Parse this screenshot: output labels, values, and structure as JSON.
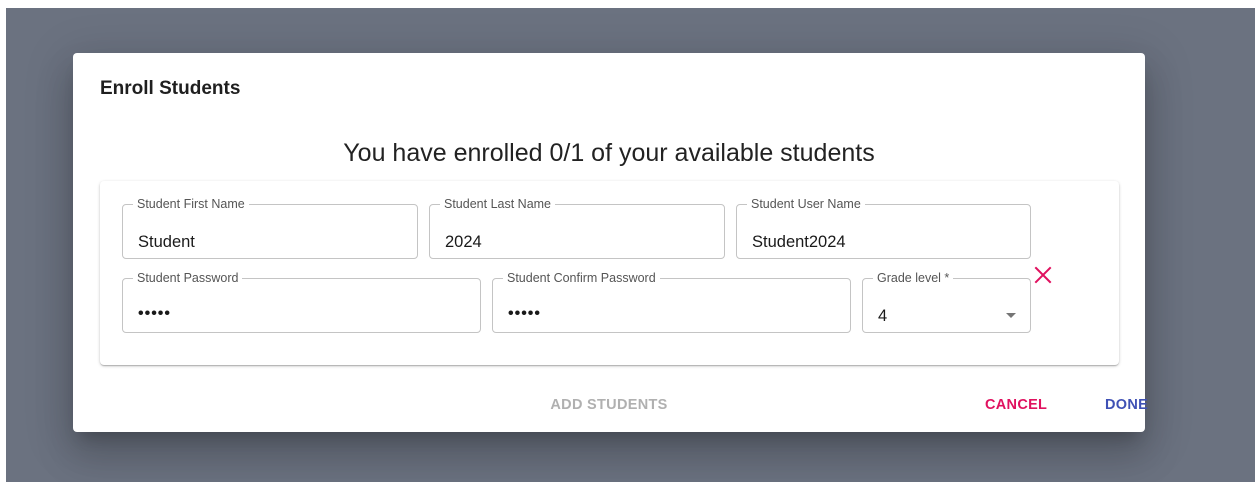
{
  "dialog": {
    "title": "Enroll Students",
    "subtitle": "You have enrolled 0/1 of your available students"
  },
  "student": {
    "first_name": {
      "label": "Student First Name",
      "value": "Student"
    },
    "last_name": {
      "label": "Student Last Name",
      "value": "2024"
    },
    "user_name": {
      "label": "Student User Name",
      "value": "Student2024"
    },
    "password": {
      "label": "Student Password",
      "value": "•••••"
    },
    "confirm_password": {
      "label": "Student Confirm Password",
      "value": "•••••"
    },
    "grade_level": {
      "label": "Grade level *",
      "value": "4"
    }
  },
  "actions": {
    "add_students": "ADD STUDENTS",
    "cancel": "CANCEL",
    "done": "DONE"
  },
  "colors": {
    "cancel": "#e0115f",
    "done": "#3f51b5",
    "remove_icon": "#e0115f",
    "disabled": "#b0b0b0"
  },
  "icons": {
    "remove": "close-icon",
    "select": "arrow-drop-down-icon"
  }
}
